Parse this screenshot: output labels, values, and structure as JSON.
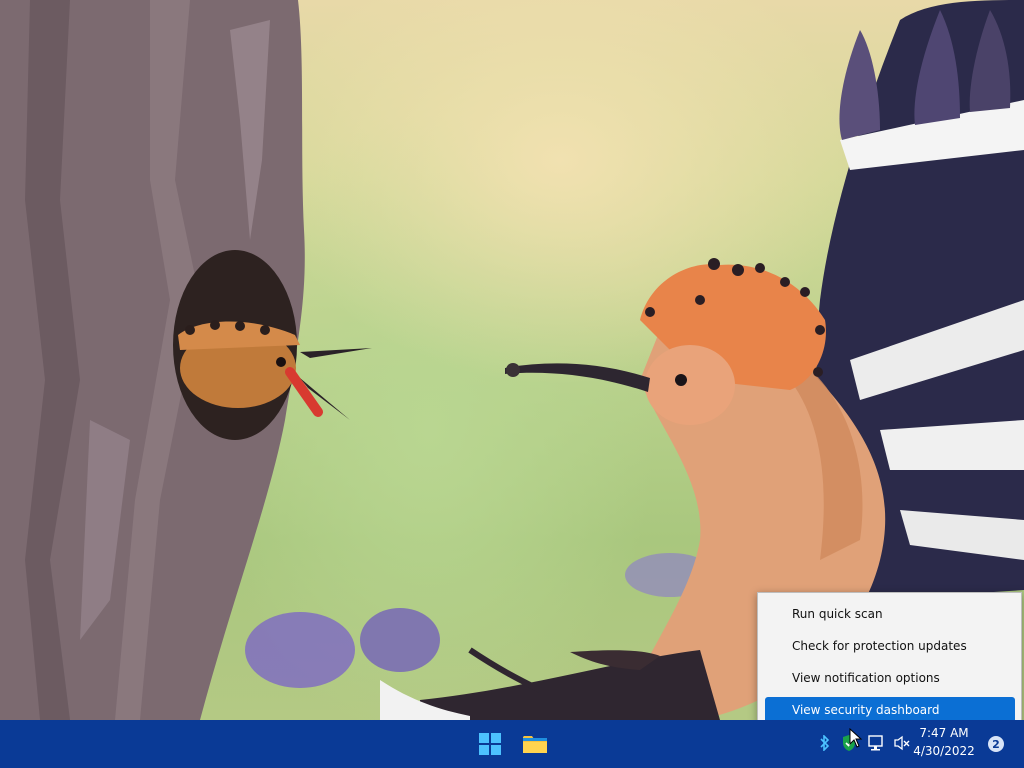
{
  "context_menu": {
    "items": [
      {
        "label": "Run quick scan",
        "selected": false
      },
      {
        "label": "Check for protection updates",
        "selected": false
      },
      {
        "label": "View notification options",
        "selected": false
      },
      {
        "label": "View security dashboard",
        "selected": true
      }
    ]
  },
  "taskbar": {
    "pinned": [
      {
        "name": "start-button",
        "icon": "windows-logo-icon"
      },
      {
        "name": "file-explorer-button",
        "icon": "folder-icon"
      }
    ],
    "tray_icons": [
      "bluetooth-icon",
      "windows-security-icon",
      "network-icon",
      "volume-muted-icon"
    ],
    "clock": {
      "time": "7:47 AM",
      "date": "4/30/2022"
    },
    "notification_count": "2"
  },
  "colors": {
    "taskbar": "#0a3a96",
    "menu_selected": "#0b6fd4",
    "menu_background": "#f3f3f3"
  }
}
